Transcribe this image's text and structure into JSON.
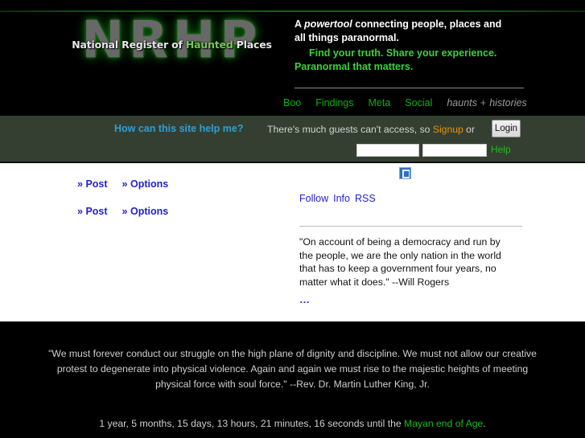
{
  "site": {
    "logo_main": "NRHP",
    "logo_sub_part1": "National Register of ",
    "logo_sub_haunted": "Haunted",
    "logo_sub_part2": " Places"
  },
  "tagline": {
    "line1_pre": "A ",
    "line1_em": "powertool",
    "line1_post": " connecting people, places and",
    "line2": "all things paranormal.",
    "line3": "Find your truth. Share your experience.",
    "line4": "Paranormal that matters."
  },
  "nav": {
    "items": [
      {
        "label": "Boo"
      },
      {
        "label": "Findings"
      },
      {
        "label": "Meta"
      },
      {
        "label": "Social"
      }
    ],
    "tags": {
      "haunts": "haunts",
      "plus": "+",
      "histories": "histories"
    }
  },
  "loginbar": {
    "help_question": "How can this site help me?",
    "guest_pre": "There's much guests can't access, so ",
    "signup_label": "Signup",
    "guest_post": " or",
    "login_button": "Login",
    "username_value": "",
    "username_placeholder": "",
    "password_value": "",
    "password_placeholder": "",
    "help_label": "Help"
  },
  "main": {
    "rows": [
      {
        "post_label": "Post",
        "options_label": "Options",
        "chevron": "»"
      },
      {
        "post_label": "Post",
        "options_label": "Options",
        "chevron": "»"
      }
    ],
    "broken_image_alt": "broken-image",
    "follow_links": [
      {
        "label": "Follow"
      },
      {
        "label": "Info"
      },
      {
        "label": "RSS"
      }
    ],
    "quote": "\"On account of being a democracy and run by the people, we are the only nation in the world that has to keep a government four years, no matter what it does.\" --Will Rogers",
    "quote_more": "…"
  },
  "footer": {
    "quote": "\"We must forever conduct our struggle on the high plane of dignity and discipline. We must not allow our creative protest to degenerate into physical violence. Again and again we must rise to the majestic heights of meeting physical force with soul force.\" --Rev. Dr. Martin Luther King, Jr.",
    "countdown_text": "1 year, 5 months, 15 days, 13 hours, 21 minutes, 16 seconds until the ",
    "countdown_link": "Mayan end of Age",
    "countdown_period": "."
  },
  "colors": {
    "accent_green": "#11ad11",
    "link_blue": "#2222cc",
    "signup_orange": "#e8920a",
    "help_blue": "#2e9fd6",
    "loginbar_bg": "#343f31",
    "page_bg": "#000000"
  }
}
